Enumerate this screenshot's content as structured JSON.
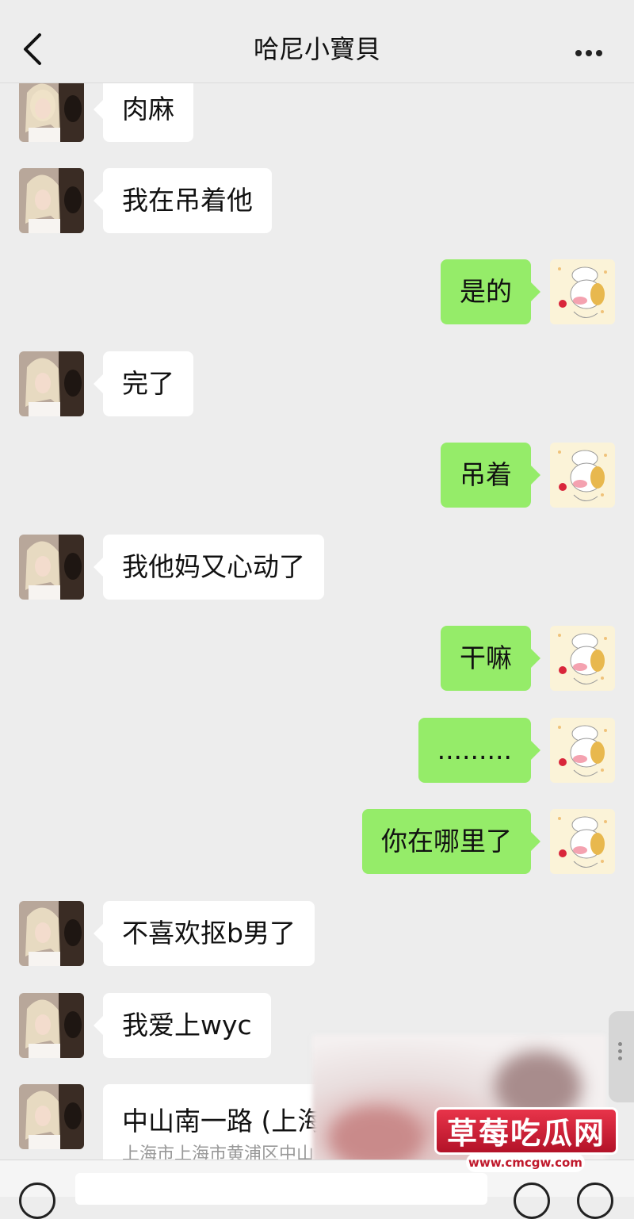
{
  "header": {
    "title": "哈尼小寶貝"
  },
  "messages": [
    {
      "side": "in",
      "text": "肉麻"
    },
    {
      "side": "in",
      "text": "我在吊着他"
    },
    {
      "side": "out",
      "text": "是的"
    },
    {
      "side": "in",
      "text": "完了"
    },
    {
      "side": "out",
      "text": "吊着"
    },
    {
      "side": "in",
      "text": "我他妈又心动了"
    },
    {
      "side": "out",
      "text": "干嘛"
    },
    {
      "side": "out",
      "text": "........."
    },
    {
      "side": "out",
      "text": "你在哪里了"
    },
    {
      "side": "in",
      "text": "不喜欢抠b男了"
    },
    {
      "side": "in",
      "text": "我爱上wyc"
    }
  ],
  "location": {
    "name": "中山南一路 (上海",
    "address": "上海市上海市黄浦区中山"
  },
  "watermark": {
    "title": "草莓吃瓜网",
    "url": "www.cmcgw.com"
  },
  "colors": {
    "incoming": "#ffffff",
    "outgoing": "#95ec69",
    "background": "#ededed"
  }
}
